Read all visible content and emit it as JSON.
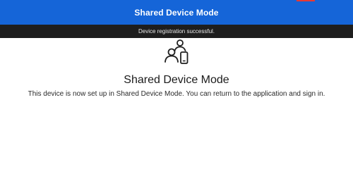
{
  "header": {
    "title": "Shared Device Mode",
    "accent_color": "#1565d8"
  },
  "toast": {
    "message": "Device registration successful.",
    "background": "#1e1e1e"
  },
  "content": {
    "icon": "shared-device-users-icon",
    "title": "Shared Device Mode",
    "description": "This device is now set up in Shared Device Mode. You can return to the application and sign in."
  }
}
